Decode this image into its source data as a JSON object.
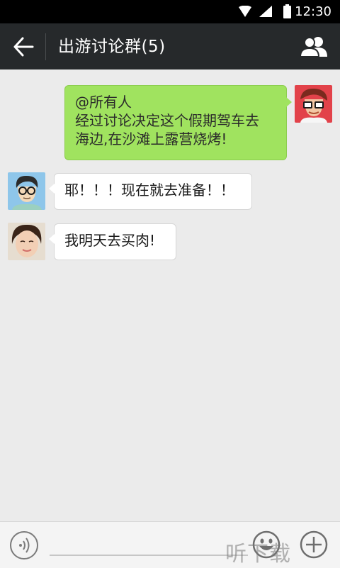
{
  "status_bar": {
    "time": "12:30"
  },
  "header": {
    "title": "出游讨论群(5)"
  },
  "messages": [
    {
      "sender": "me",
      "lines": [
        "@所有人",
        "经过讨论决定这个假期驾车去",
        "海边,在沙滩上露营烧烤!"
      ]
    },
    {
      "sender": "other",
      "lines": [
        "耶！！！现在就去准备！！"
      ]
    },
    {
      "sender": "other",
      "lines": [
        "我明天去买肉!"
      ]
    }
  ],
  "input": {
    "value": ""
  },
  "watermark": "听下载",
  "colors": {
    "titlebar": "#26292b",
    "my_bubble": "#a0e35f",
    "background": "#ebebeb"
  }
}
